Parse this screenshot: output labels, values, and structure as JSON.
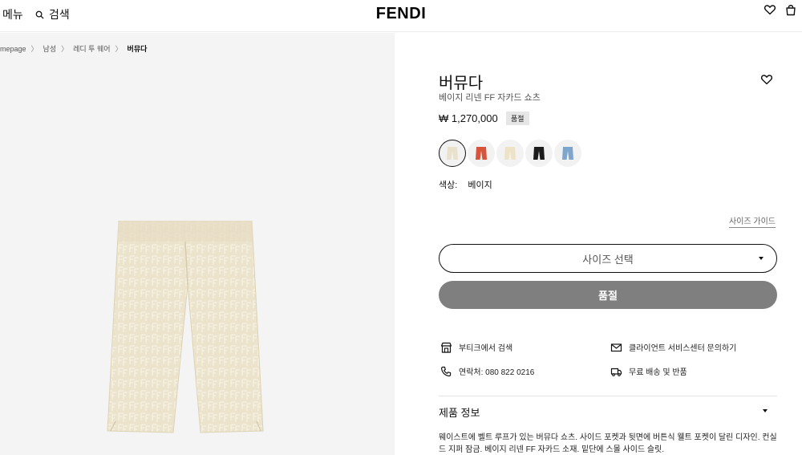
{
  "header": {
    "menu_label": "메뉴",
    "search_label": "검색",
    "logo": "FENDI"
  },
  "breadcrumb": {
    "items": [
      "mepage",
      "남성",
      "레디 투 웨어"
    ],
    "current": "버뮤다"
  },
  "product": {
    "title": "버뮤다",
    "subtitle": "베이지 리넨 FF 자카드 쇼츠",
    "price": "₩ 1,270,000",
    "badge": "품절",
    "color_label": "색상:",
    "color_value": "베이지",
    "swatches": [
      {
        "name": "beige",
        "color": "#e9e1cc",
        "selected": true
      },
      {
        "name": "orange",
        "color": "#d5543a"
      },
      {
        "name": "cream",
        "color": "#eee3c7"
      },
      {
        "name": "black",
        "color": "#1c1c1c"
      },
      {
        "name": "denim",
        "color": "#7ea6cc"
      }
    ],
    "image_color": "#ece3cc"
  },
  "size": {
    "guide_label": "사이즈 가이드",
    "select_label": "사이즈 선택"
  },
  "cta": {
    "soldout_label": "품절"
  },
  "services": {
    "boutique": "부티크에서 검색",
    "client_service": "클라이언트 서비스센터 문의하기",
    "contact": "연락처: 080 822 0216",
    "shipping": "무료 배송 및 반품"
  },
  "info": {
    "heading": "제품 정보",
    "description": "웨이스트에 벨트 루프가 있는 버뮤다 쇼츠. 사이드 포켓과 뒷면에 버튼식 웰트 포켓이 달린 디자인. 컨실드 지퍼 잠금. 베이지 리넨 FF 자카드 소재. 밑단에 스몰 사이드 슬릿."
  },
  "icons": {
    "search": "search-icon",
    "heart": "heart-icon",
    "bag": "shopping-bag-icon",
    "chevron": "chevron-right-icon",
    "store": "store-icon",
    "mail": "mail-icon",
    "phone": "phone-icon",
    "truck": "truck-icon"
  }
}
